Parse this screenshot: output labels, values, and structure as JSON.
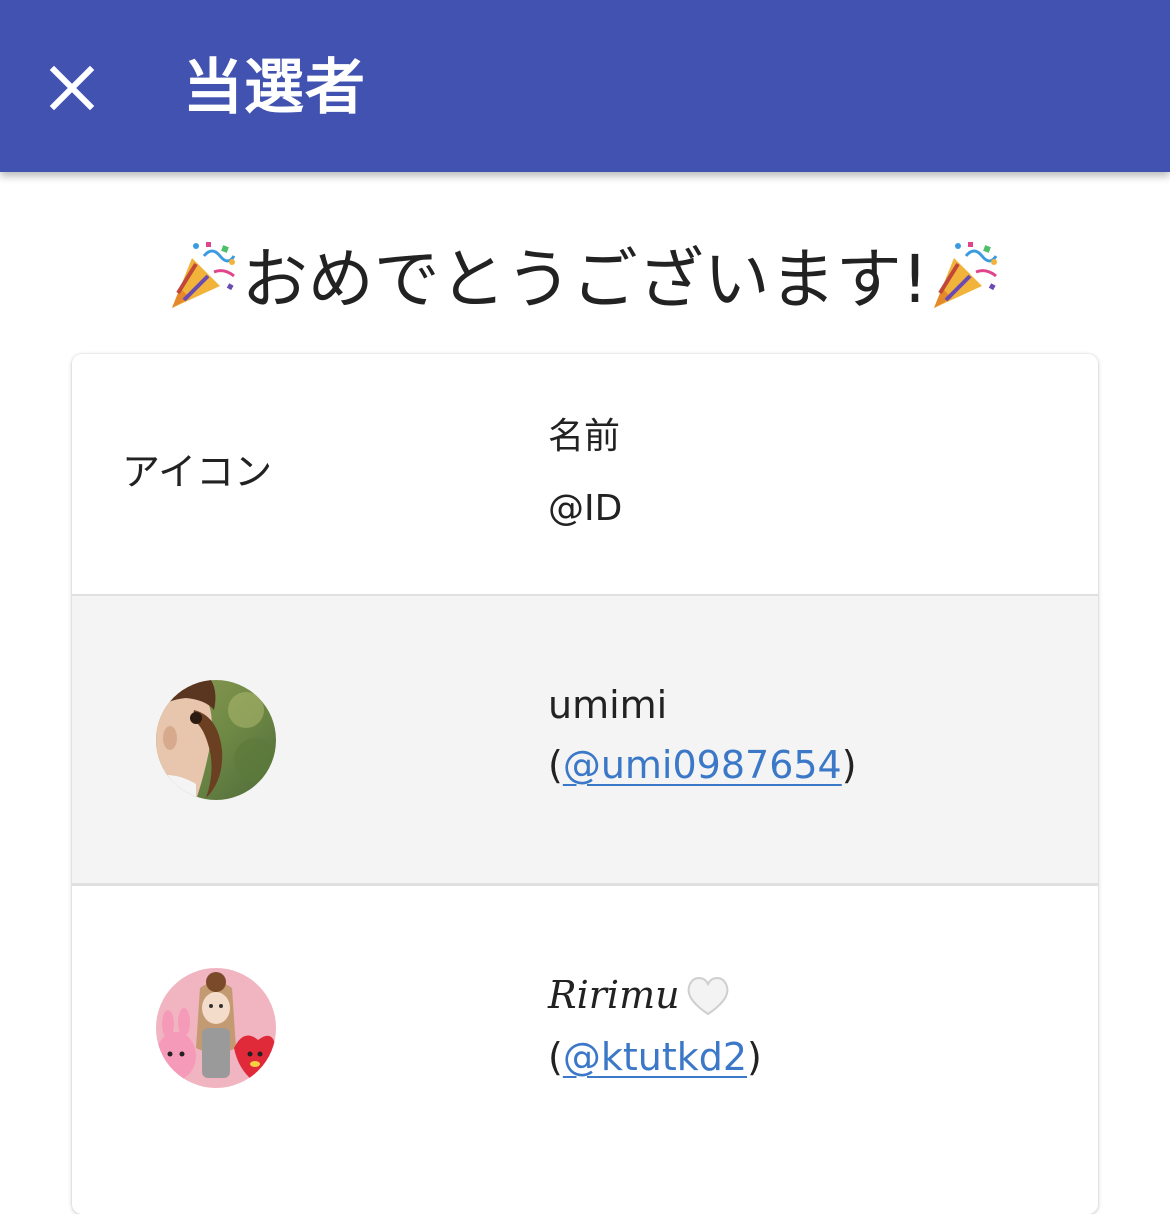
{
  "appbar": {
    "title": "当選者",
    "close_icon": "close-icon",
    "background_color": "#4152b0"
  },
  "banner": {
    "text": "おめでとうございます!",
    "emoji_icon": "party-popper-icon"
  },
  "table": {
    "headers": {
      "icon": "アイコン",
      "name": "名前",
      "id": "@ID"
    },
    "rows": [
      {
        "avatar_icon": "avatar-ponytail-photo",
        "name": "umimi",
        "id_open": "(",
        "id": "@umi0987654",
        "id_close": ")"
      },
      {
        "avatar_icon": "avatar-doll-with-characters",
        "name": "𝑅𝑖𝑟𝑖𝑚𝑢",
        "name_emoji": "white-heart-icon",
        "id_open": "(",
        "id": "@ktutkd2",
        "id_close": ")"
      }
    ]
  },
  "colors": {
    "link": "#3b78c8",
    "row_alt": "#f4f4f4"
  }
}
